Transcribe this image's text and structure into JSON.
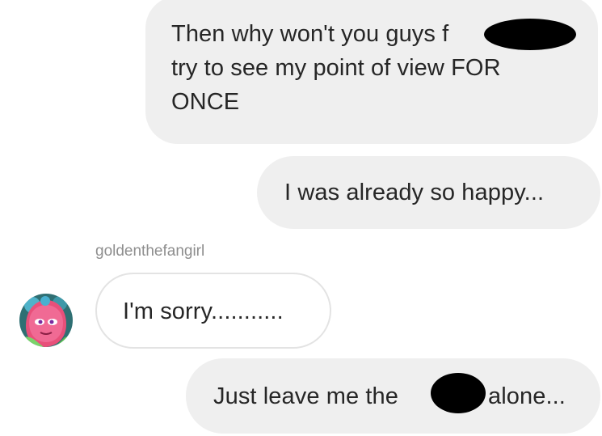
{
  "messages": [
    {
      "direction": "outgoing",
      "lines": [
        "Then why won't you guys f",
        "try to see my point of view FOR",
        "ONCE"
      ]
    },
    {
      "direction": "outgoing",
      "text": "I was already so happy..."
    },
    {
      "direction": "incoming",
      "sender": "goldenthefangirl",
      "text": "I'm sorry..........."
    },
    {
      "direction": "outgoing",
      "text_before": "Just leave me the",
      "text_after": "alone..."
    }
  ],
  "colors": {
    "outgoing_bubble": "#efefef",
    "incoming_bubble_border": "#e3e3e3",
    "text": "#262626",
    "sender_label": "#8e8e8e",
    "redaction": "#000000"
  }
}
